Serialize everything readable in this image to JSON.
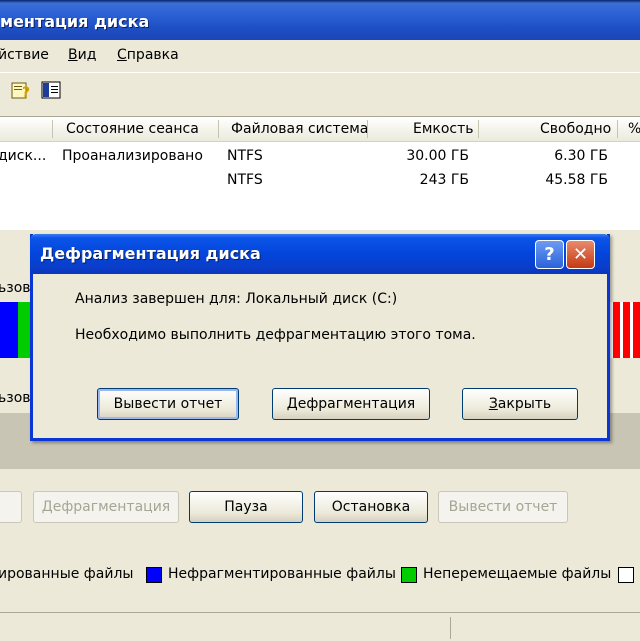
{
  "window": {
    "title": "ментация диска"
  },
  "menu": {
    "items": [
      {
        "label": "йствие",
        "underline": ""
      },
      {
        "label": "Вид",
        "underline": "В"
      },
      {
        "label": "Справка",
        "underline": "С"
      }
    ]
  },
  "toolbar": {
    "icons": [
      "help-topic-icon",
      "show-hide-pane-icon"
    ]
  },
  "volume_list": {
    "columns": [
      "Состояние сеанса",
      "Файловая система",
      "Емкость",
      "Свободно",
      "%"
    ],
    "rows": [
      {
        "volume": "диск...",
        "status": "Проанализировано",
        "fs": "NTFS",
        "capacity": "30.00 ГБ",
        "free": "6.30 ГБ"
      },
      {
        "volume": "",
        "status": "",
        "fs": "NTFS",
        "capacity": "243 ГБ",
        "free": "45.58 ГБ"
      }
    ]
  },
  "analysis": {
    "label_before": "ьзов",
    "label_after": "ьзов"
  },
  "buttons": {
    "defrag": "Дефрагментация",
    "pause": "Пауза",
    "stop": "Остановка",
    "report": "Вывести отчет"
  },
  "legend": {
    "items": [
      {
        "label": "ированные файлы",
        "color": "#ff0000"
      },
      {
        "label": "Нефрагментированные файлы",
        "color": "#0000ff"
      },
      {
        "label": "Неперемещаемые файлы",
        "color": "#00cc00"
      },
      {
        "label": "",
        "color": "#ffffff"
      }
    ]
  },
  "dialog": {
    "title": "Дефрагментация диска",
    "help_glyph": "?",
    "close_glyph": "✕",
    "line1": "Анализ завершен для: Локальный диск (C:)",
    "line2": "Необходимо выполнить дефрагментацию этого тома.",
    "btn_report": "Вывести отчет",
    "btn_defrag": "Дефрагментация",
    "btn_close": "Закрыть"
  },
  "colors": {
    "fragmented": "#ff0000",
    "contiguous": "#0000ff",
    "unmovable": "#00cc00",
    "free": "#ffffff"
  }
}
